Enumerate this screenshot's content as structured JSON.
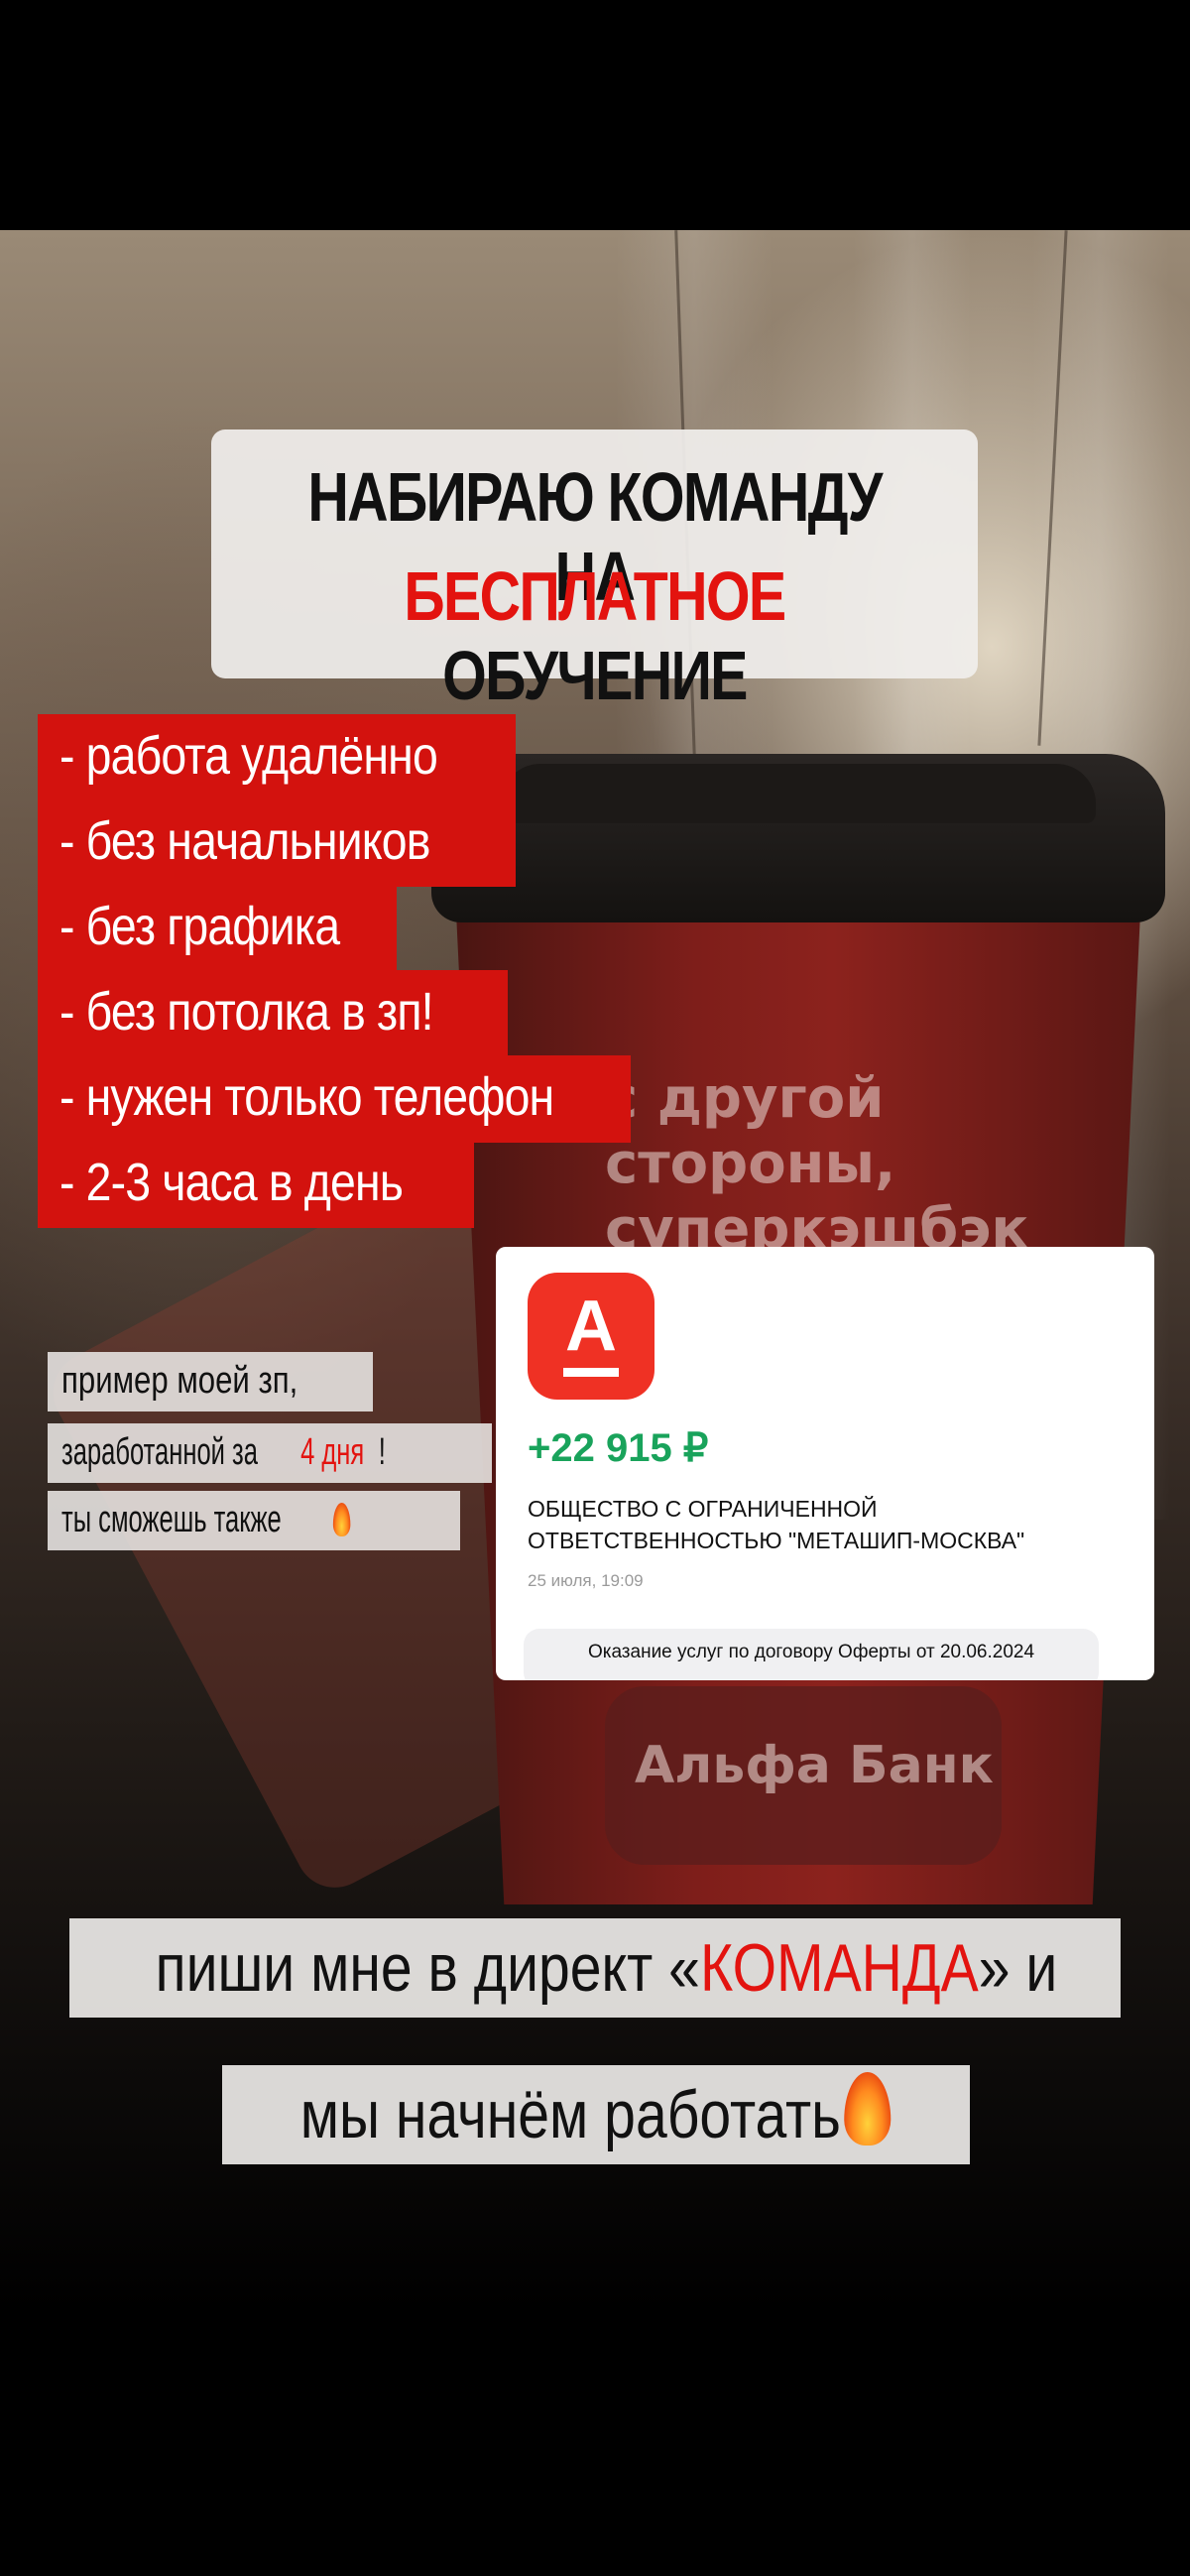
{
  "title": {
    "line1": "НАБИРАЮ КОМАНДУ НА",
    "line2_highlight": "БЕСПЛАТНОЕ",
    "line2_rest": " ОБУЧЕНИЕ"
  },
  "bullets": [
    "- работа удалённо",
    "- без начальников",
    "- без графика",
    "- без потолка в зп!",
    "- нужен только телефон",
    "- 2-3 часа в день"
  ],
  "note": {
    "line1": "пример моей зп,",
    "line2_before": "заработанной за ",
    "line2_highlight": "4 дня",
    "line2_after": "!",
    "line3": "ты сможешь также"
  },
  "bank_card": {
    "amount": "+22 915 ₽",
    "company_line1": "ОБЩЕСТВО С ОГРАНИЧЕННОЙ",
    "company_line2": "ОТВЕТСТВЕННОСТЬЮ \"МЕТАШИП-МОСКВА\"",
    "date": "25 июля, 19:09",
    "description": "Оказание услуг по договору Оферты от 20.06.2024",
    "logo_letter": "А"
  },
  "cup": {
    "print_line1": "с другой",
    "print_line2": "стороны,",
    "print_line3": "суперкэшбэк –",
    "label": "Альфа Банк"
  },
  "cta": {
    "line1_before": "пиши мне в директ «",
    "line1_highlight": "КОМАНДА",
    "line1_after": "» и",
    "line2": "мы начнём работать"
  },
  "colors": {
    "accent_red": "#e3130f",
    "bullet_bg": "#d3120e",
    "bank_red": "#ef3124",
    "amount_green": "#19a35b"
  },
  "icons": [
    "fire-emoji-icon",
    "alfa-bank-logo-icon"
  ]
}
